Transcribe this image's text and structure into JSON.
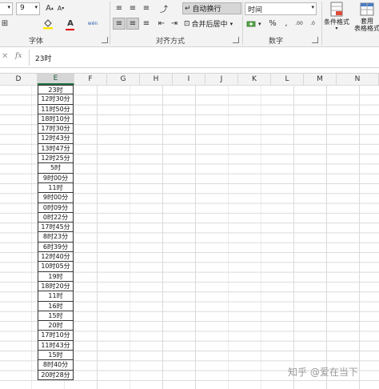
{
  "ribbon": {
    "font_size": "9",
    "font_group_label": "字体",
    "align_group_label": "对齐方式",
    "number_group_label": "数字",
    "wrap_text": "自动换行",
    "merge_center": "合并后居中",
    "number_format": "时间",
    "percent": "%",
    "comma": ",",
    "conditional_format": "条件格式",
    "format_table_line1": "套用",
    "format_table_line2": "表格格式",
    "wen": "wén",
    "font_color_letter": "A",
    "fx": "fx"
  },
  "formula": {
    "value": "23时"
  },
  "columns": [
    "D",
    "E",
    "F",
    "G",
    "H",
    "I",
    "J",
    "K",
    "L",
    "M",
    "N"
  ],
  "e_values": [
    "23时",
    "12时30分",
    "11时50分",
    "18时10分",
    "17时30分",
    "12时43分",
    "13时47分",
    "12时25分",
    "5时",
    "9时00分",
    "11时",
    "9时00分",
    "0时09分",
    "0时22分",
    "17时45分",
    "8时23分",
    "6时39分",
    "12时40分",
    "10时05分",
    "19时",
    "18时20分",
    "11时",
    "16时",
    "15时",
    "20时",
    "17时10分",
    "11时43分",
    "15时",
    "8时40分",
    "20时28分"
  ],
  "watermark": "知乎 @爱在当下",
  "accent_color": "#217346"
}
